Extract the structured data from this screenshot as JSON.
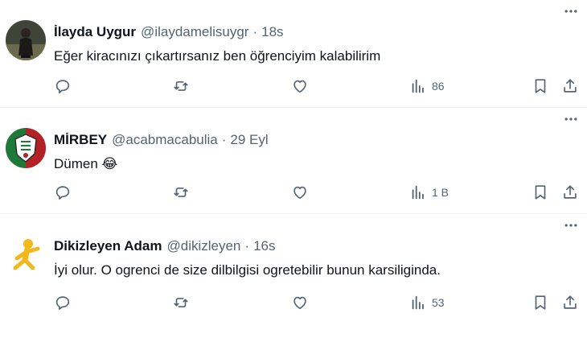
{
  "tweets": [
    {
      "name": "İlayda Uygur",
      "handle": "@ilaydamelisuygr",
      "time": "18s",
      "text": "Eğer kiracınızı çıkartırsanız ben öğrenciyim kalabilirim",
      "views": "86",
      "avatar": "avatar-person-photo"
    },
    {
      "name": "MİRBEY",
      "handle": "@acabmacabulia",
      "time": "29 Eyl",
      "text": "Dümen 😂",
      "views": "1 B",
      "avatar": "avatar-team-crest"
    },
    {
      "name": "Dikizleyen Adam",
      "handle": "@dikizleyen",
      "time": "16s",
      "text": "İyi olur. O ogrenci de size dilbilgisi ogretebilir bunun karsiliginda.",
      "views": "53",
      "avatar": "avatar-yellow-figure"
    }
  ],
  "separator": "·",
  "colors": {
    "text": "#0f1419",
    "secondary": "#536471",
    "divider": "#eff3f4"
  }
}
